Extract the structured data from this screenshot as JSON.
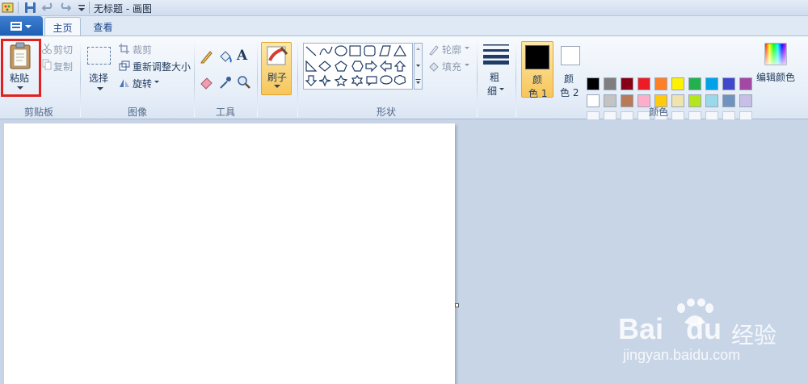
{
  "window": {
    "title": "无标题 - 画图"
  },
  "tabs": [
    {
      "label": "主页"
    },
    {
      "label": "查看"
    }
  ],
  "clipboard": {
    "paste_label": "粘贴",
    "cut_label": "剪切",
    "copy_label": "复制",
    "group_label": "剪贴板"
  },
  "image": {
    "select_label": "选择",
    "crop_label": "裁剪",
    "resize_label": "重新调整大小",
    "rotate_label": "旋转",
    "group_label": "图像"
  },
  "tools": {
    "group_label": "工具",
    "text_tool_glyph": "A"
  },
  "brushes": {
    "label": "刷子"
  },
  "shapes": {
    "outline_label": "轮廓",
    "fill_label": "填充",
    "group_label": "形状"
  },
  "size": {
    "label_line1": "粗",
    "label_line2": "细"
  },
  "colors": {
    "color1_line1": "颜",
    "color1_line2": "色 1",
    "color2_line1": "颜",
    "color2_line2": "色 2",
    "edit_label": "编辑颜色",
    "group_label": "颜色",
    "color1_value": "#000000",
    "color2_value": "#ffffff",
    "palette_row1": [
      "#000000",
      "#7f7f7f",
      "#880015",
      "#ed1c24",
      "#ff7f27",
      "#fff200",
      "#22b14c",
      "#00a2e8",
      "#3f48cc",
      "#a349a4"
    ],
    "palette_row2": [
      "#ffffff",
      "#c3c3c3",
      "#b97a57",
      "#ffaec9",
      "#ffc90e",
      "#efe4b0",
      "#b5e61d",
      "#99d9ea",
      "#7092be",
      "#c8bfe7"
    ],
    "palette_row3": [
      "",
      "",
      "",
      "",
      "",
      "",
      "",
      "",
      "",
      ""
    ]
  },
  "watermark": {
    "brand": "Bai",
    "brand2": "du",
    "product": "经验",
    "url": "jingyan.baidu.com"
  }
}
